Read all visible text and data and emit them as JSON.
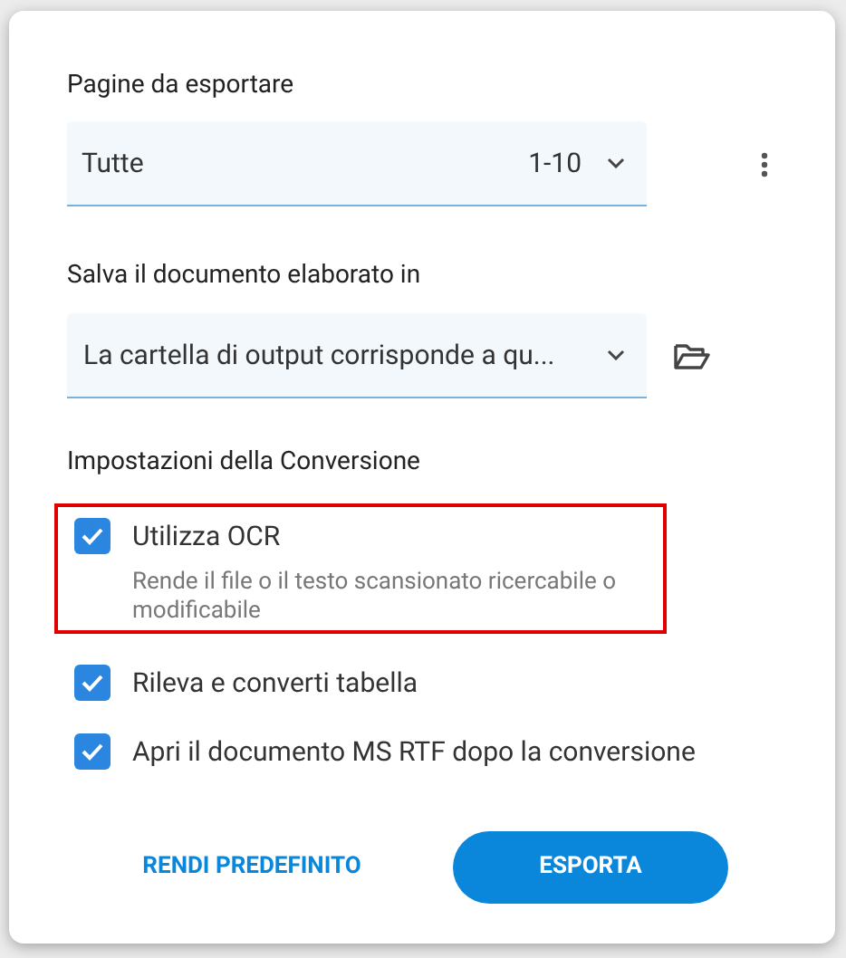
{
  "pages_section": {
    "label": "Pagine da esportare",
    "select": {
      "value": "Tutte",
      "range": "1-10"
    }
  },
  "output_section": {
    "label": "Salva il documento elaborato in",
    "select": {
      "value": "La cartella di output corrisponde a qu..."
    }
  },
  "conversion_settings": {
    "heading": "Impostazioni della Conversione",
    "options": [
      {
        "label": "Utilizza OCR",
        "checked": true,
        "highlighted": true,
        "description": "Rende il file o il testo scansionato ricercabile o modificabile"
      },
      {
        "label": "Rileva e converti tabella",
        "checked": true,
        "highlighted": false
      },
      {
        "label": "Apri il documento MS RTF dopo la conversione",
        "checked": true,
        "highlighted": false
      }
    ]
  },
  "buttons": [
    {
      "label": "RENDI PREDEFINITO",
      "kind": "text"
    },
    {
      "label": "ESPORTA",
      "kind": "primary"
    }
  ]
}
